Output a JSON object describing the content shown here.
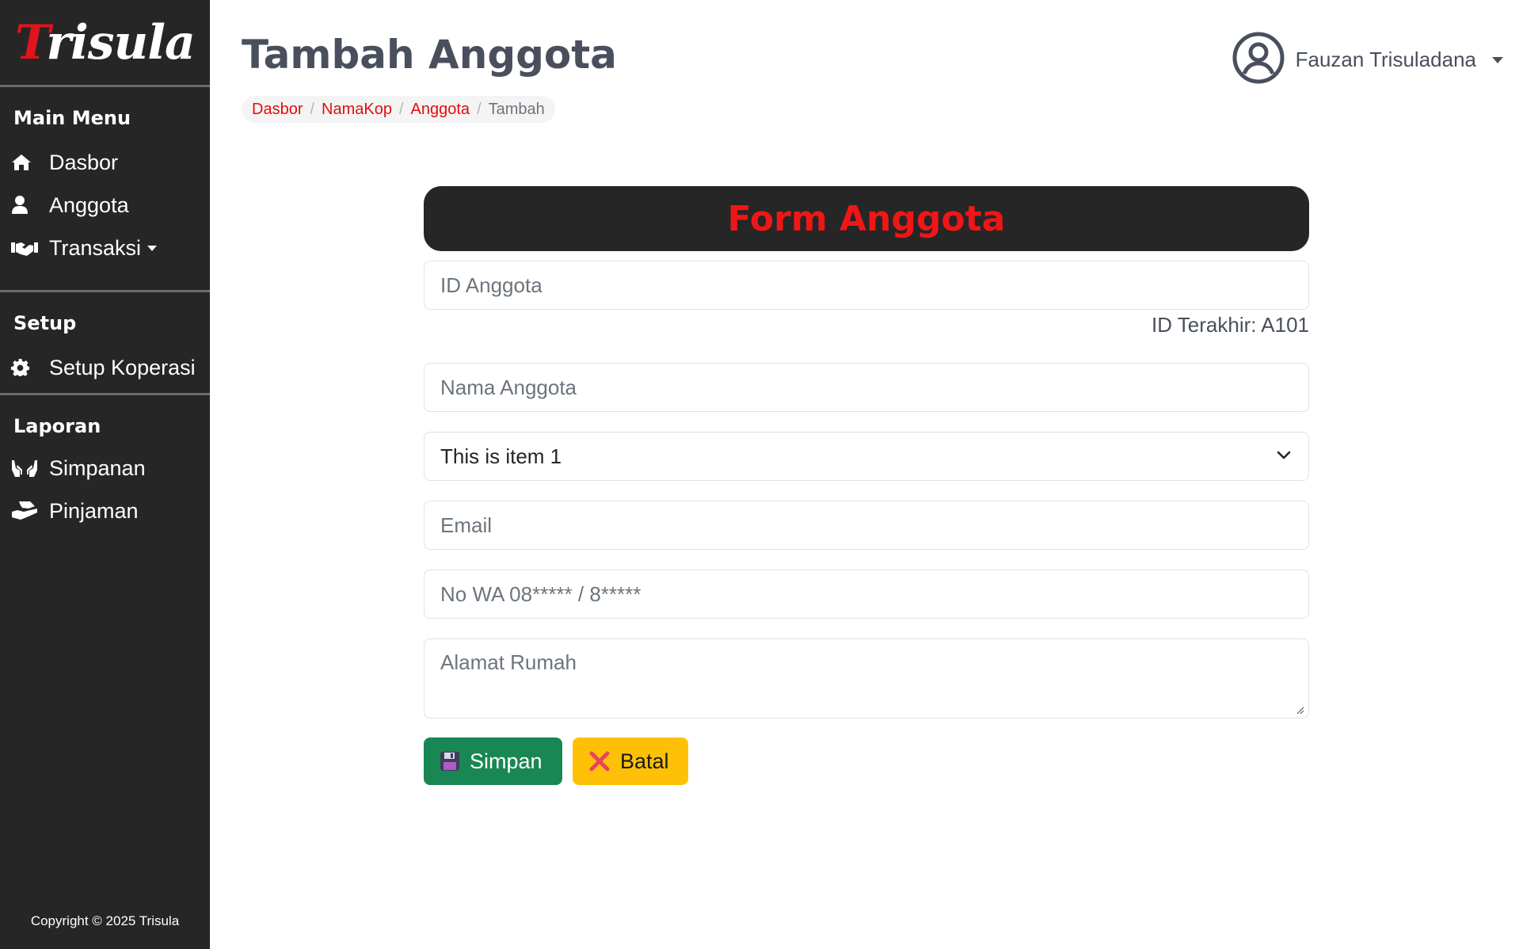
{
  "sidebar": {
    "brand": {
      "first": "T",
      "rest": "risula"
    },
    "sections": [
      {
        "title": "Main Menu",
        "items": [
          {
            "label": "Dasbor",
            "icon": "home-icon"
          },
          {
            "label": "Anggota",
            "icon": "user-icon"
          },
          {
            "label": "Transaksi",
            "icon": "handshake-icon",
            "dropdown": true
          }
        ]
      },
      {
        "title": "Setup",
        "items": [
          {
            "label": "Setup Koperasi",
            "icon": "gear-icon"
          }
        ]
      },
      {
        "title": "Laporan",
        "items": [
          {
            "label": "Simpanan",
            "icon": "hands-icon"
          },
          {
            "label": "Pinjaman",
            "icon": "hand-holding-icon"
          }
        ]
      }
    ],
    "copyright": "Copyright © 2025 Trisula"
  },
  "header": {
    "title": "Tambah Anggota",
    "breadcrumb": [
      "Dasbor",
      "NamaKop",
      "Anggota",
      "Tambah"
    ],
    "user": {
      "name": "Fauzan Trisuladana",
      "icon": "user-circle-icon"
    }
  },
  "form": {
    "title": "Form Anggota",
    "id_placeholder": "ID Anggota",
    "id_hint": "ID Terakhir: A101",
    "name_placeholder": "Nama Anggota",
    "select_value": "This is item 1",
    "email_placeholder": "Email",
    "wa_placeholder": "No WA 08***** / 8*****",
    "address_placeholder": "Alamat Rumah",
    "save_label": "Simpan",
    "cancel_label": "Batal"
  },
  "colors": {
    "sidebar_bg": "#262626",
    "accent_red": "#e30d0d",
    "save_green": "#198754",
    "cancel_yellow": "#ffc107"
  }
}
